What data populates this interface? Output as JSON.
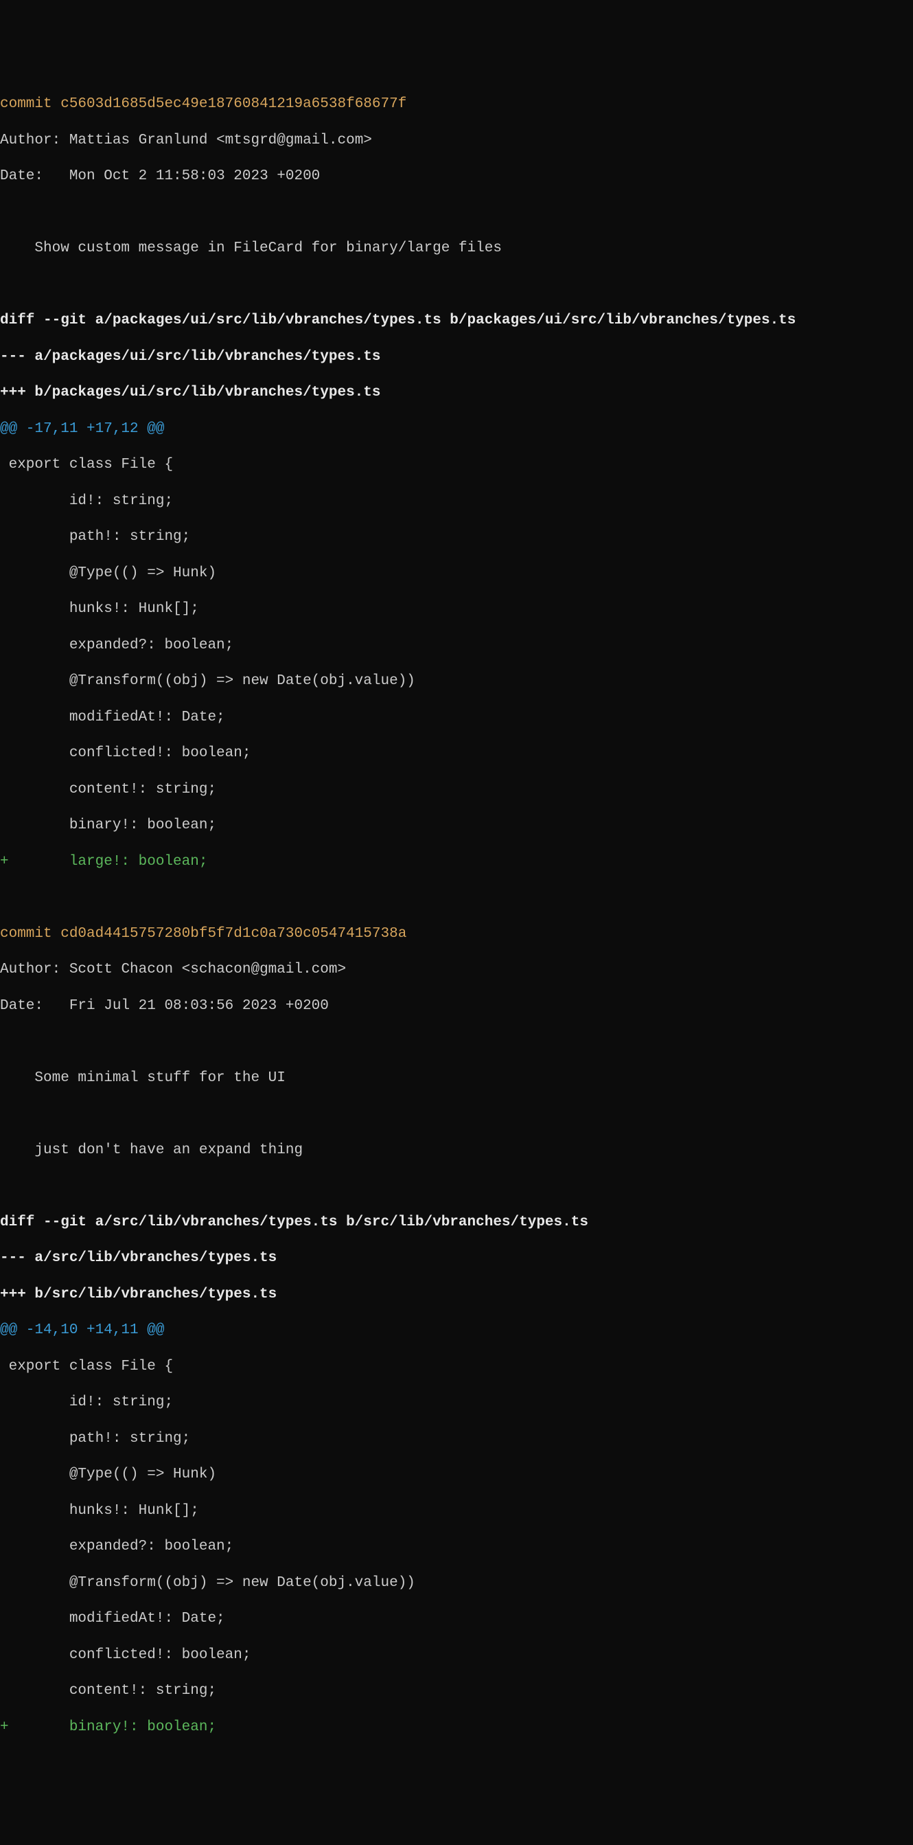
{
  "commits": [
    {
      "commit_label": "commit ",
      "hash": "c5603d1685d5ec49e18760841219a6538f68677f",
      "author_label": "Author: ",
      "author": "Mattias Granlund <mtsgrd@gmail.com>",
      "date_label": "Date:   ",
      "date": "Mon Oct 2 11:58:03 2023 +0200",
      "message_lines": [
        "    Show custom message in FileCard for binary/large files"
      ],
      "diff_header": [
        "diff --git a/packages/ui/src/lib/vbranches/types.ts b/packages/ui/src/lib/vbranches/types.ts",
        "--- a/packages/ui/src/lib/vbranches/types.ts",
        "+++ b/packages/ui/src/lib/vbranches/types.ts"
      ],
      "hunk_header": "@@ -17,11 +17,12 @@",
      "context_lines": [
        " export class File {",
        "        id!: string;",
        "        path!: string;",
        "        @Type(() => Hunk)",
        "        hunks!: Hunk[];",
        "        expanded?: boolean;",
        "        @Transform((obj) => new Date(obj.value))",
        "        modifiedAt!: Date;",
        "        conflicted!: boolean;",
        "        content!: string;",
        "        binary!: boolean;"
      ],
      "added_lines": [
        "+       large!: boolean;"
      ]
    },
    {
      "commit_label": "commit ",
      "hash": "cd0ad4415757280bf5f7d1c0a730c0547415738a",
      "author_label": "Author: ",
      "author": "Scott Chacon <schacon@gmail.com>",
      "date_label": "Date:   ",
      "date": "Fri Jul 21 08:03:56 2023 +0200",
      "message_lines": [
        "    Some minimal stuff for the UI",
        "",
        "    just don't have an expand thing"
      ],
      "diff_header": [
        "diff --git a/src/lib/vbranches/types.ts b/src/lib/vbranches/types.ts",
        "--- a/src/lib/vbranches/types.ts",
        "+++ b/src/lib/vbranches/types.ts"
      ],
      "hunk_header": "@@ -14,10 +14,11 @@",
      "context_lines": [
        " export class File {",
        "        id!: string;",
        "        path!: string;",
        "        @Type(() => Hunk)",
        "        hunks!: Hunk[];",
        "        expanded?: boolean;",
        "        @Transform((obj) => new Date(obj.value))",
        "        modifiedAt!: Date;",
        "        conflicted!: boolean;",
        "        content!: string;"
      ],
      "added_lines": [
        "+       binary!: boolean;"
      ]
    }
  ]
}
